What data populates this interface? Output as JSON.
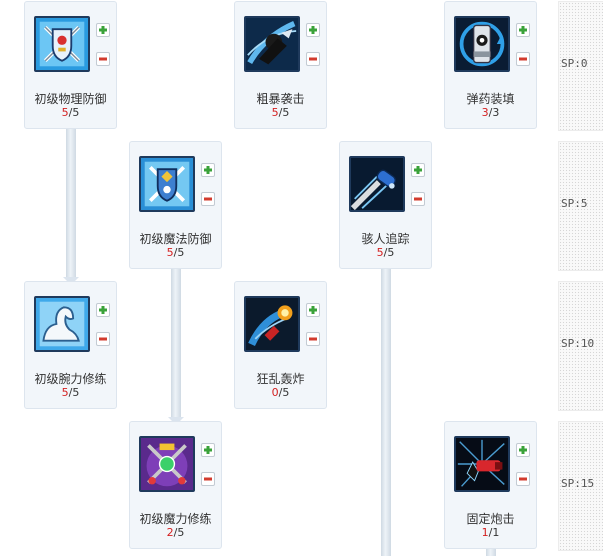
{
  "skills": [
    {
      "name": "初级物理防御",
      "level_current": "5",
      "level_max": "/5",
      "icon": "shield-swords-icon"
    },
    {
      "name": "粗暴袭击",
      "level_current": "5",
      "level_max": "/5",
      "icon": "brute-strike-icon"
    },
    {
      "name": "弹药装填",
      "level_current": "3",
      "level_max": "/3",
      "icon": "ammo-reload-icon"
    },
    {
      "name": "初级魔法防御",
      "level_current": "5",
      "level_max": "/5",
      "icon": "magic-shield-icon"
    },
    {
      "name": "骇人追踪",
      "level_current": "5",
      "level_max": "/5",
      "icon": "tracking-missile-icon"
    },
    {
      "name": "初级腕力修练",
      "level_current": "5",
      "level_max": "/5",
      "icon": "flexed-arm-icon"
    },
    {
      "name": "狂乱轰炸",
      "level_current": "0",
      "level_max": "/5",
      "icon": "frenzy-bombard-icon"
    },
    {
      "name": "初级魔力修练",
      "level_current": "2",
      "level_max": "/5",
      "icon": "magic-power-icon"
    },
    {
      "name": "固定炮击",
      "level_current": "1",
      "level_max": "/1",
      "icon": "fixed-cannon-icon"
    }
  ],
  "sp_tiers": [
    "SP:0",
    "SP:5",
    "SP:10",
    "SP:15"
  ],
  "colors": {
    "plus": "#3aa23a",
    "minus": "#d23b2e",
    "level_current": "#d42020"
  }
}
